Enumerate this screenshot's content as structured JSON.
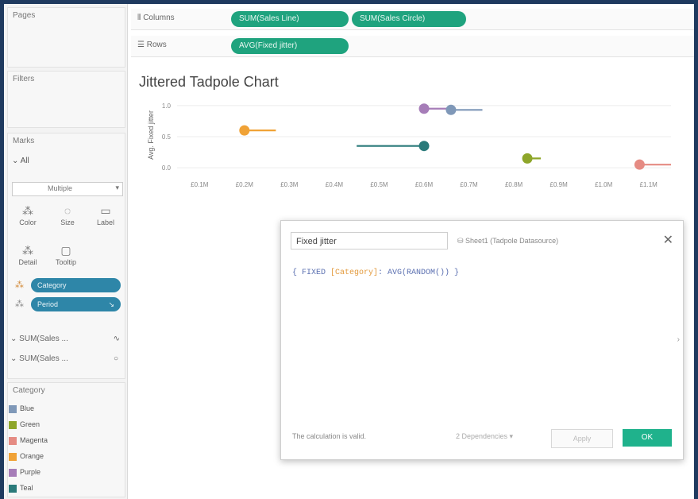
{
  "cards": {
    "pages": "Pages",
    "filters": "Filters",
    "marks": "Marks",
    "category": "Category"
  },
  "shelves": {
    "columns_label": "Columns",
    "rows_label": "Rows",
    "columns": [
      "SUM(Sales Line)",
      "SUM(Sales Circle)"
    ],
    "rows": [
      "AVG(Fixed jitter)"
    ]
  },
  "marks": {
    "all_label": "All",
    "type": "Multiple",
    "buttons": [
      "Color",
      "Size",
      "Label",
      "Detail",
      "Tooltip"
    ],
    "fields": [
      "Category",
      "Period"
    ],
    "measures": [
      "SUM(Sales ...",
      "SUM(Sales ..."
    ]
  },
  "legend": {
    "items": [
      {
        "label": "Blue",
        "color": "#7f98b8"
      },
      {
        "label": "Green",
        "color": "#8ea62a"
      },
      {
        "label": "Magenta",
        "color": "#e58b83"
      },
      {
        "label": "Orange",
        "color": "#f0a236"
      },
      {
        "label": "Purple",
        "color": "#a67db8"
      },
      {
        "label": "Teal",
        "color": "#2a7a7a"
      }
    ]
  },
  "chart_title": "Jittered Tadpole Chart",
  "chart_data": {
    "type": "scatter",
    "title": "Jittered Tadpole Chart",
    "ylabel": "Avg. Fixed jitter",
    "y_ticks": [
      "1.0",
      "0.5",
      "0.0"
    ],
    "x_ticks": [
      "£0.1M",
      "£0.2M",
      "£0.3M",
      "£0.4M",
      "£0.5M",
      "£0.6M",
      "£0.7M",
      "£0.8M",
      "£0.9M",
      "£1.0M",
      "£1.1M"
    ],
    "xlim": [
      0.05,
      1.15
    ],
    "ylim": [
      -0.05,
      1.1
    ],
    "series": [
      {
        "category": "Purple",
        "color": "#a67db8",
        "line_end": 0.65,
        "circle": 0.6,
        "y": 0.95
      },
      {
        "category": "Blue",
        "color": "#7f98b8",
        "line_end": 0.73,
        "circle": 0.66,
        "y": 0.93
      },
      {
        "category": "Orange",
        "color": "#f0a236",
        "line_end": 0.27,
        "circle": 0.2,
        "y": 0.6
      },
      {
        "category": "Teal",
        "color": "#2a7a7a",
        "line_end": 0.45,
        "circle": 0.6,
        "y": 0.35
      },
      {
        "category": "Green",
        "color": "#8ea62a",
        "line_end": 0.86,
        "circle": 0.83,
        "y": 0.15
      },
      {
        "category": "Magenta",
        "color": "#e58b83",
        "line_end": 1.15,
        "circle": 1.08,
        "y": 0.05
      }
    ]
  },
  "dialog": {
    "name": "Fixed jitter",
    "datasource": "Sheet1 (Tadpole Datasource)",
    "close": "✕",
    "formula_start": "{ FIXED ",
    "formula_field": "[Category]",
    "formula_end": ": AVG(RANDOM()) }",
    "status": "The calculation is valid.",
    "dependencies": "2 Dependencies ▾",
    "apply": "Apply",
    "ok": "OK"
  }
}
